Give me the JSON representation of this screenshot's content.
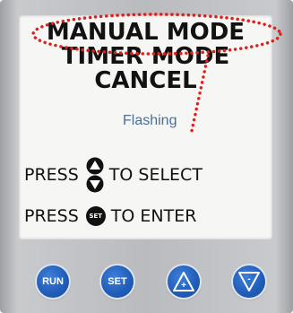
{
  "screen": {
    "menu": [
      "MANUAL MODE",
      "TIMER MODE",
      "CANCEL"
    ],
    "annotation": "Flashing",
    "instruction_select": {
      "press": "PRESS",
      "action": "TO SELECT"
    },
    "instruction_enter": {
      "press": "PRESS",
      "icon_label": "SET",
      "action": "TO ENTER"
    }
  },
  "buttons": {
    "run": "RUN",
    "set": "SET",
    "up": "+",
    "down": "-"
  },
  "colors": {
    "button_blue": "#1f5cb8",
    "annotation_red": "#e0201c",
    "annotation_text": "#4a6f9a",
    "panel_gray": "#b9bbbe"
  }
}
